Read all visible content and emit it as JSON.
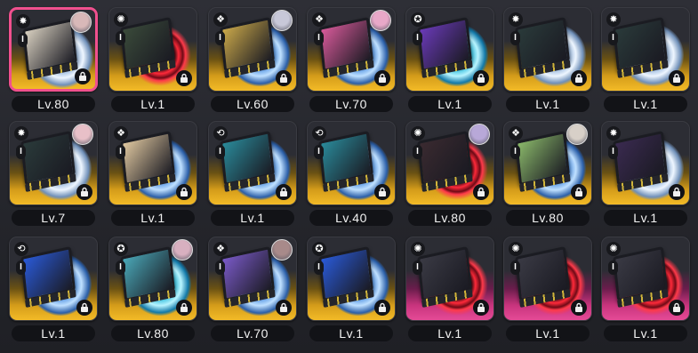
{
  "inventory": {
    "cards": [
      {
        "level": "Lv.80",
        "type_icon": "attack-icon",
        "frame": "gold",
        "disc": "white",
        "art": "#d8d0c0",
        "avatar": "#d8b8b8",
        "selected": true
      },
      {
        "level": "Lv.1",
        "type_icon": "support-icon",
        "frame": "gold",
        "disc": "red",
        "art": "#3a4a3a",
        "avatar": null,
        "selected": false
      },
      {
        "level": "Lv.60",
        "type_icon": "anomaly-icon",
        "frame": "gold",
        "disc": "default",
        "art": "#caa84a",
        "avatar": "#c8c8d8",
        "selected": false
      },
      {
        "level": "Lv.70",
        "type_icon": "anomaly-icon",
        "frame": "gold",
        "disc": "default",
        "art": "#d85a9a",
        "avatar": "#e8a8c8",
        "selected": false
      },
      {
        "level": "Lv.1",
        "type_icon": "stun-icon",
        "frame": "gold",
        "disc": "aqua",
        "art": "#6a3ab8",
        "avatar": null,
        "selected": false
      },
      {
        "level": "Lv.1",
        "type_icon": "attack-icon",
        "frame": "gold",
        "disc": "white",
        "art": "#2a3a3a",
        "avatar": null,
        "selected": false
      },
      {
        "level": "Lv.1",
        "type_icon": "attack-icon",
        "frame": "gold",
        "disc": "white",
        "art": "#2a3a3a",
        "avatar": null,
        "selected": false
      },
      {
        "level": "Lv.7",
        "type_icon": "attack-icon",
        "frame": "gold",
        "disc": "white",
        "art": "#2a3a3a",
        "avatar": "#e8c0c8",
        "selected": false
      },
      {
        "level": "Lv.1",
        "type_icon": "anomaly-icon",
        "frame": "gold",
        "disc": "default",
        "art": "#e0c8a0",
        "avatar": null,
        "selected": false
      },
      {
        "level": "Lv.1",
        "type_icon": "defense-icon",
        "frame": "gold",
        "disc": "default",
        "art": "#2a8a9a",
        "avatar": null,
        "selected": false
      },
      {
        "level": "Lv.40",
        "type_icon": "defense-icon",
        "frame": "gold",
        "disc": "default",
        "art": "#2a8a9a",
        "avatar": null,
        "selected": false
      },
      {
        "level": "Lv.80",
        "type_icon": "support-icon",
        "frame": "gold",
        "disc": "red",
        "art": "#3a2a30",
        "avatar": "#b8a8d8",
        "selected": false
      },
      {
        "level": "Lv.80",
        "type_icon": "anomaly-icon",
        "frame": "gold",
        "disc": "default",
        "art": "#8ab86a",
        "avatar": "#d8d0c8",
        "selected": false
      },
      {
        "level": "Lv.1",
        "type_icon": "attack-icon",
        "frame": "gold",
        "disc": "white",
        "art": "#3a2a50",
        "avatar": null,
        "selected": false
      },
      {
        "level": "Lv.1",
        "type_icon": "defense-icon",
        "frame": "gold",
        "disc": "default",
        "art": "#2a5ad8",
        "avatar": null,
        "selected": false
      },
      {
        "level": "Lv.80",
        "type_icon": "stun-icon",
        "frame": "gold",
        "disc": "aqua",
        "art": "#4aa8b8",
        "avatar": "#d8b0c0",
        "selected": false
      },
      {
        "level": "Lv.70",
        "type_icon": "anomaly-icon",
        "frame": "gold",
        "disc": "default",
        "art": "#7a5ac8",
        "avatar": "#a88a8a",
        "selected": false
      },
      {
        "level": "Lv.1",
        "type_icon": "stun-icon",
        "frame": "gold",
        "disc": "default",
        "art": "#2a5ad8",
        "avatar": null,
        "selected": false
      },
      {
        "level": "Lv.1",
        "type_icon": "support-icon",
        "frame": "pink",
        "disc": "red",
        "art": "#3a3a44",
        "avatar": null,
        "selected": false
      },
      {
        "level": "Lv.1",
        "type_icon": "support-icon",
        "frame": "pink",
        "disc": "red",
        "art": "#3a3a44",
        "avatar": null,
        "selected": false
      },
      {
        "level": "Lv.1",
        "type_icon": "support-icon",
        "frame": "pink",
        "disc": "red",
        "art": "#3a3a44",
        "avatar": null,
        "selected": false
      }
    ],
    "rank_label": "I"
  },
  "colors": {
    "gold": "#f3bb27",
    "pink": "#e54a96",
    "selected_border": "#f0508e",
    "level_bg": "#121317"
  }
}
